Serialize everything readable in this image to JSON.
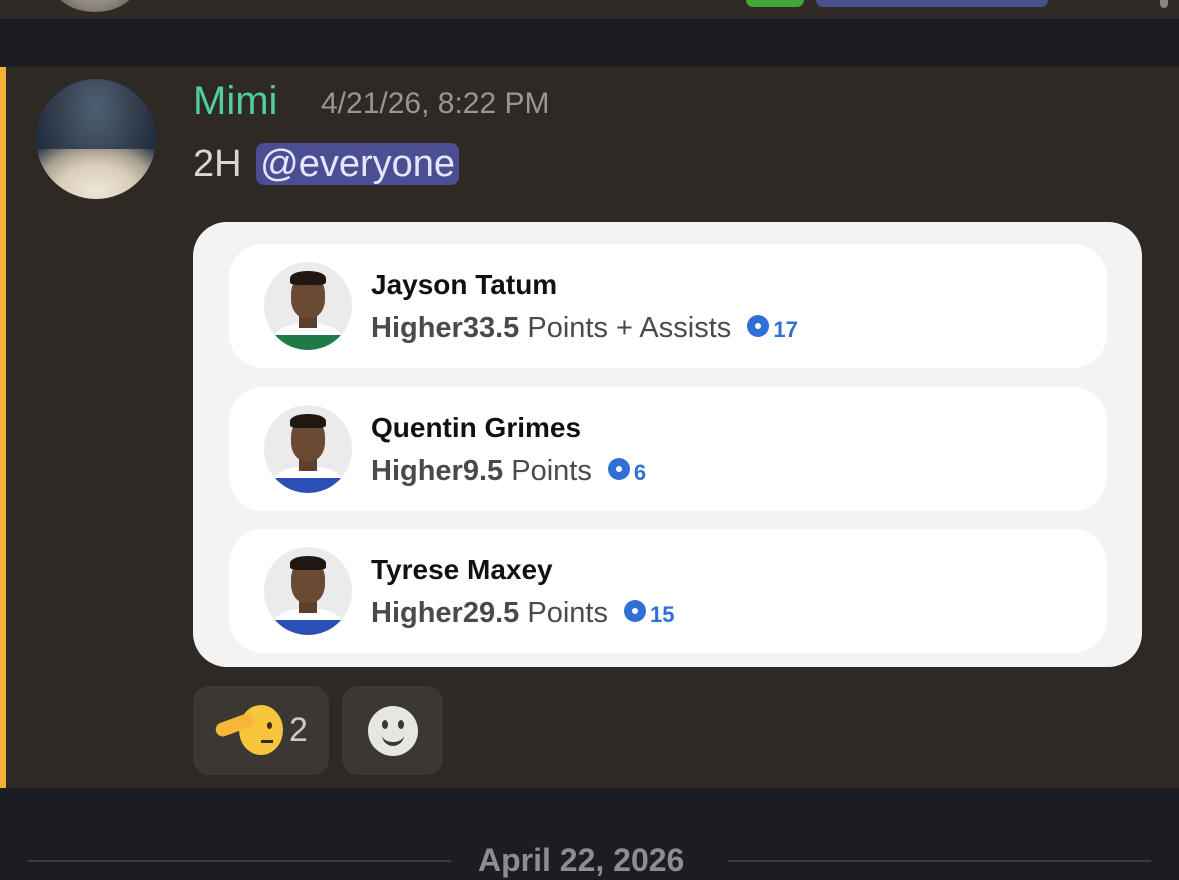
{
  "message": {
    "username": "Mimi",
    "timestamp": "4/21/26, 8:22 PM",
    "content_prefix": "2H",
    "mention": "@everyone"
  },
  "card": {
    "picks": [
      {
        "name": "Jayson Tatum",
        "direction": "Higher",
        "line": "33.5",
        "stat": "Points + Assists",
        "count": "17"
      },
      {
        "name": "Quentin Grimes",
        "direction": "Higher",
        "line": "9.5",
        "stat": "Points",
        "count": "6"
      },
      {
        "name": "Tyrese Maxey",
        "direction": "Higher",
        "line": "29.5",
        "stat": "Points",
        "count": "15"
      }
    ]
  },
  "reactions": [
    {
      "emoji": "saluting-face",
      "count": "2"
    },
    {
      "emoji": "add-reaction"
    }
  ],
  "divider": {
    "date": "April 22, 2026"
  },
  "colors": {
    "username": "#4fcf9a",
    "mention_bg": "#4b4e90",
    "mention_bar": "#f0b232",
    "count_blue": "#2f6fd6"
  }
}
